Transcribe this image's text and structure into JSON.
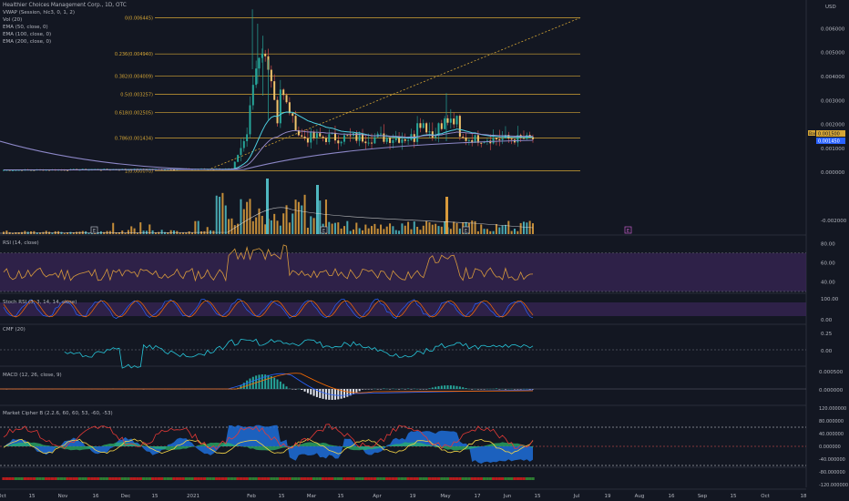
{
  "legend": {
    "symbol": "Healthier Choices Management Corp., 1D, OTC",
    "lines": [
      "VWAP (Session, hlc3, 0, 1, 2)",
      "Vol (20)",
      "EMA (50, close, 0)",
      "EMA (100, close, 0)",
      "EMA (200, close, 0)"
    ]
  },
  "currency": "USD",
  "panes": {
    "rsi": "RSI (14, close)",
    "stoch": "Stoch RSI (3, 3, 14, 14, close)",
    "cmf": "CMF (20)",
    "macd": "MACD (12, 26, close, 9)",
    "mcb": "Market Cipher B (2.2.6, 60, 60, 53, -60, -53)"
  },
  "price_axis": [
    "0.006000",
    "0.005000",
    "0.004000",
    "0.003000",
    "0.002000",
    "0.001000",
    "0.000000",
    "-0.002000"
  ],
  "rsi_axis": [
    "80.00",
    "60.00",
    "40.00"
  ],
  "stoch_axis": [
    "100.00",
    "0.00"
  ],
  "cmf_axis": [
    "0.25",
    "0.00"
  ],
  "macd_axis": [
    "0.000500",
    "0.000000"
  ],
  "mcb_axis": [
    "120.000000",
    "80.000000",
    "40.000000",
    "0.000000",
    "-40.000000",
    "-80.000000",
    "-120.000000"
  ],
  "price_tags": {
    "bar": "Bar",
    "last": "0.001500",
    "prev": "0.001450"
  },
  "time_axis": [
    "Oct",
    "15",
    "Nov",
    "16",
    "Dec",
    "15",
    "2021",
    "Feb",
    "15",
    "Mar",
    "15",
    "Apr",
    "19",
    "May",
    "17",
    "Jun",
    "15",
    "Jul",
    "19",
    "Aug",
    "16",
    "Sep",
    "15",
    "Oct",
    "18"
  ],
  "earnings_marker": "E",
  "fib_levels": [
    {
      "label": "0(0.006445)",
      "price": 0.006445
    },
    {
      "label": "0.236(0.004940)",
      "price": 0.00494
    },
    {
      "label": "0.382(0.004009)",
      "price": 0.004009
    },
    {
      "label": "0.5(0.003257)",
      "price": 0.003257
    },
    {
      "label": "0.618(0.002505)",
      "price": 0.002505
    },
    {
      "label": "0.786(0.001434)",
      "price": 0.001434
    },
    {
      "label": "1(0.000070)",
      "price": 7e-05
    }
  ],
  "colors": {
    "background": "#131722",
    "up": "#26a69a",
    "down": "#ef5350",
    "fib": "#d4a535",
    "volume": "#d89a3c",
    "ema": "#4dd0e1",
    "rsi_band": "#3a2759",
    "blue": "#1e6fd9"
  },
  "chart_data": {
    "type": "candlestick",
    "title": "Healthier Choices Management Corp., 1D, OTC",
    "ylabel": "USD",
    "ylim": [
      -0.0025,
      0.007
    ],
    "x": [
      "Oct",
      "15",
      "Nov",
      "16",
      "Dec",
      "15",
      "2021",
      "Feb",
      "15",
      "Mar",
      "15",
      "Apr",
      "19",
      "May",
      "17",
      "Jun",
      "15"
    ],
    "close_approx": [
      8e-05,
      8e-05,
      9e-05,
      0.0001,
      0.0001,
      0.00012,
      0.0002,
      0.0023,
      0.0045,
      0.0014,
      0.0016,
      0.0012,
      0.0015,
      0.0027,
      0.0016,
      0.0013,
      0.0015
    ],
    "last_price": 0.0015,
    "rsi_approx": [
      52,
      48,
      55,
      50,
      45,
      50,
      58,
      75,
      72,
      42,
      45,
      40,
      50,
      70,
      48,
      42,
      48
    ]
  }
}
